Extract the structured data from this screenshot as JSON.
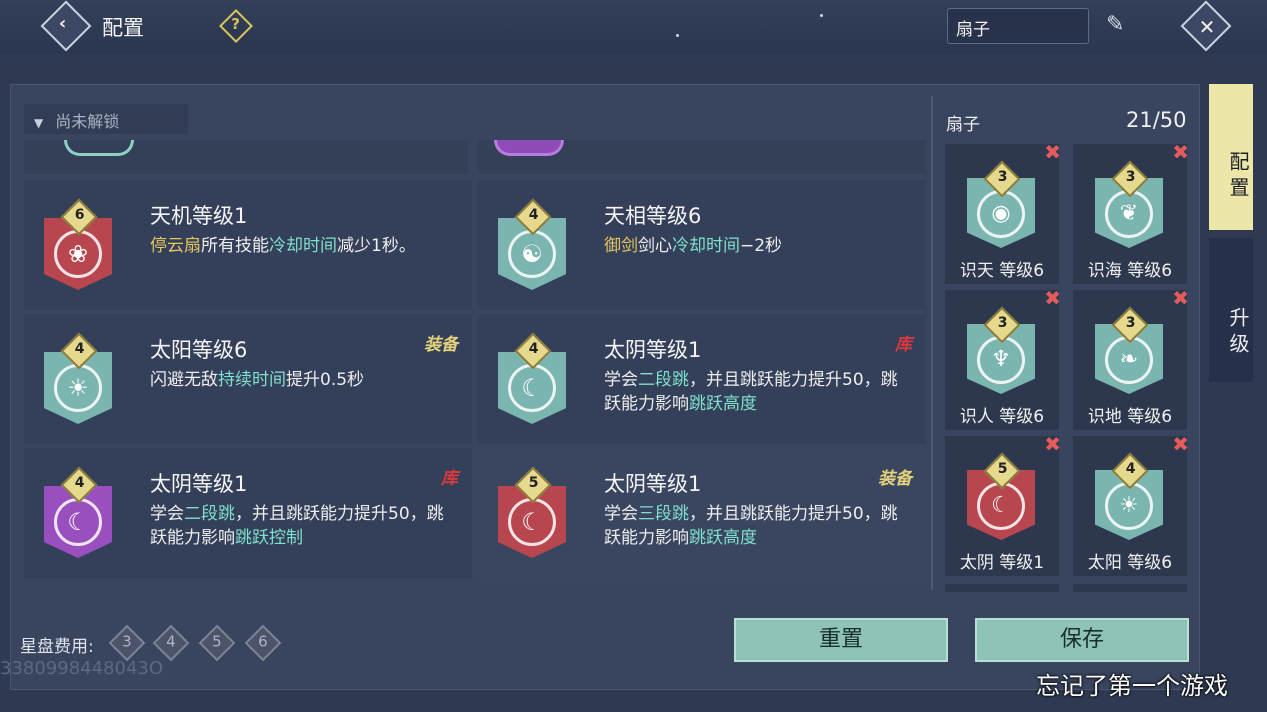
{
  "header": {
    "title": "配置",
    "help_icon": "question-diamond-icon",
    "weapon": "扇子"
  },
  "filter": {
    "label": "尚未解锁"
  },
  "cards": [
    {
      "level": "6",
      "title": "天机等级1",
      "tag": "",
      "color": "#b8464f",
      "desc": [
        {
          "t": "停云扇",
          "c": "gold"
        },
        {
          "t": "所有技能",
          "c": ""
        },
        {
          "t": "冷却时间",
          "c": "teal"
        },
        {
          "t": "减少1秒。",
          "c": ""
        }
      ]
    },
    {
      "level": "4",
      "title": "天相等级6",
      "tag": "",
      "color": "#7ab5b0",
      "desc": [
        {
          "t": "御剑",
          "c": "gold"
        },
        {
          "t": "剑心",
          "c": ""
        },
        {
          "t": "冷却时间",
          "c": "teal"
        },
        {
          "t": "−2秒",
          "c": ""
        }
      ]
    },
    {
      "level": "4",
      "title": "太阳等级6",
      "tag": "装备",
      "color": "#7ab5b0",
      "desc": [
        {
          "t": "闪避无敌",
          "c": ""
        },
        {
          "t": "持续时间",
          "c": "teal"
        },
        {
          "t": "提升0.5秒",
          "c": ""
        }
      ]
    },
    {
      "level": "4",
      "title": "太阴等级1",
      "tag": "库",
      "color": "#7ab5b0",
      "desc": [
        {
          "t": "学会",
          "c": ""
        },
        {
          "t": "二段跳",
          "c": "teal"
        },
        {
          "t": "，并且跳跃能力提升50，跳跃能力影响",
          "c": ""
        },
        {
          "t": "跳跃高度",
          "c": "teal"
        }
      ]
    },
    {
      "level": "4",
      "title": "太阴等级1",
      "tag": "库",
      "color": "#9a4fbf",
      "desc": [
        {
          "t": "学会",
          "c": ""
        },
        {
          "t": "二段跳",
          "c": "teal"
        },
        {
          "t": "，并且跳跃能力提升50，跳跃能力影响",
          "c": ""
        },
        {
          "t": "跳跃控制",
          "c": "teal"
        }
      ]
    },
    {
      "level": "5",
      "title": "太阴等级1",
      "tag": "装备",
      "color": "#b8464f",
      "desc": [
        {
          "t": "学会",
          "c": ""
        },
        {
          "t": "三段跳",
          "c": "teal"
        },
        {
          "t": "，并且跳跃能力提升50，跳跃能力影响",
          "c": ""
        },
        {
          "t": "跳跃高度",
          "c": "teal"
        }
      ]
    }
  ],
  "right": {
    "title": "扇子",
    "count": "21/50",
    "slots": [
      {
        "level": "3",
        "name": "识天 等级6",
        "color": "#7ab5b0",
        "icon": "eye-icon"
      },
      {
        "level": "3",
        "name": "识海 等级6",
        "color": "#7ab5b0",
        "icon": "coral-icon"
      },
      {
        "level": "3",
        "name": "识人 等级6",
        "color": "#7ab5b0",
        "icon": "figure-icon"
      },
      {
        "level": "3",
        "name": "识地 等级6",
        "color": "#7ab5b0",
        "icon": "tree-icon"
      },
      {
        "level": "5",
        "name": "太阴 等级1",
        "color": "#b8464f",
        "icon": "moon-icon"
      },
      {
        "level": "4",
        "name": "太阳 等级6",
        "color": "#7ab5b0",
        "icon": "sun-icon"
      }
    ]
  },
  "tabs": {
    "active": "配置",
    "inactive": "升级"
  },
  "bottom": {
    "cost_label": "星盘费用:",
    "costs": [
      "3",
      "4",
      "5",
      "6"
    ],
    "reset": "重置",
    "save": "保存"
  },
  "watermark": "3380998448043O",
  "caption": "忘记了第一个游戏"
}
